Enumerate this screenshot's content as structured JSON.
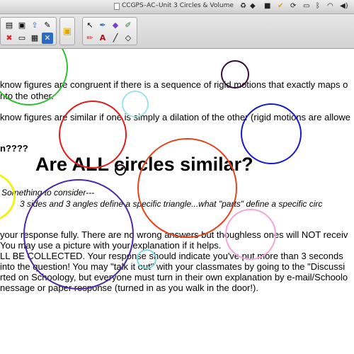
{
  "window": {
    "title": "CCGPS–AC–Unit 3 Circles & Volume"
  },
  "menubar": {
    "tray_icons": [
      "recycle-icon",
      "dropbox-icon",
      "adobe-icon",
      "checkmark-icon",
      "sync-icon",
      "monitor-icon",
      "bluetooth-icon",
      "wifi-icon",
      "volume-icon"
    ]
  },
  "toolbar": {
    "left_icons": [
      "document-icon",
      "folder-icon",
      "import-icon",
      "app-icon",
      "delete-icon",
      "screen-icon",
      "capture-icon",
      "close-doc-icon"
    ],
    "center_icon": "lock-icon",
    "tool_icons": [
      "select-arrow-icon",
      "pen-icon",
      "eraser-icon",
      "paint-icon",
      "highlighter-icon",
      "text-icon",
      "line-icon",
      "shape-eraser-icon"
    ]
  },
  "canvas": {
    "line1": "know figures are congruent if there is a sequence of rigid motions that exactly maps o",
    "line1b": "nto the other.",
    "line2": "know figures are similar if one is simply a dilation of the other (rigid motions are allowe",
    "question_fragment": "n????",
    "heading": "Are ALL circles similar?",
    "prompt_italic": "Something to consider---",
    "prompt_line2": "3 sides and 3 angles define a specific triangle...what \"parts\" define a specific circ",
    "p1": "your response fully.  There are no wrong answers but thoughless ones will NOT receiv",
    "p2": "You may use a picture with your explanation if it helps.",
    "p3": "LL BE COLLECTED.  Your response should indicate you've put more than 3 seconds",
    "p4": "into the question!  You may \"talk it out\" with your classmates by going to the \"Discussi",
    "p5": "rted on Schoology, but everyone must turn in their own explanation by e-mail/Schoolo",
    "p6": "nessage or paper response (turned in as you walk in the door!)."
  },
  "colors": {
    "green": "#2fc22f",
    "dark_purple": "#3a0a3a",
    "light_cyan": "#9fe3e8",
    "red": "#e01b1b",
    "blue": "#1a1ac8",
    "orange_red": "#e4431f",
    "yellow": "#f2f21a",
    "purple": "#4d2aa8",
    "pink": "#f2a6d8",
    "teal": "#7ad8e0",
    "black": "#111111"
  }
}
